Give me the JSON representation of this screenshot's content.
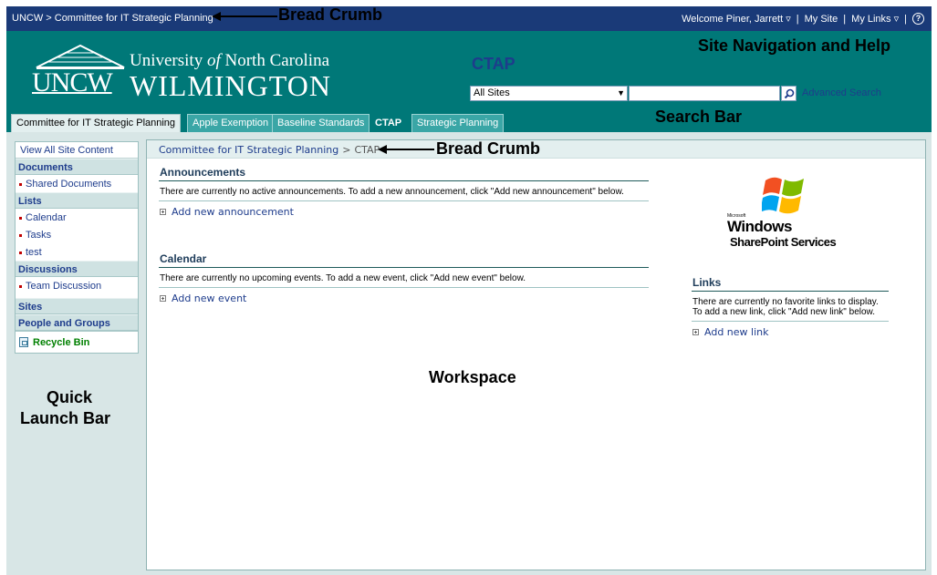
{
  "topbar": {
    "breadcrumb": "UNCW > Committee for IT Strategic Planning",
    "welcome": "Welcome Piner, Jarrett ▿",
    "sep": "|",
    "my_site": "My Site",
    "my_links": "My Links ▿",
    "help_glyph": "?"
  },
  "header": {
    "logo_abbr": "UNCW",
    "logo_line1_a": "University ",
    "logo_line1_of": "of",
    "logo_line1_b": " North Carolina",
    "logo_line2": "WILMINGTON",
    "site_title": "CTAP",
    "search_scope": "All Sites",
    "search_value": "",
    "advanced_search": "Advanced Search"
  },
  "tabs": [
    {
      "label": "Committee for IT Strategic Planning"
    },
    {
      "label": "Apple Exemption"
    },
    {
      "label": "Baseline Standards"
    },
    {
      "label": "CTAP"
    },
    {
      "label": "Strategic Planning"
    }
  ],
  "quicklaunch": {
    "view_all": "View All Site Content",
    "documents": "Documents",
    "shared_documents": "Shared Documents",
    "lists": "Lists",
    "calendar": "Calendar",
    "tasks": "Tasks",
    "test": "test",
    "discussions": "Discussions",
    "team_discussion": "Team Discussion",
    "sites": "Sites",
    "people_groups": "People and Groups",
    "recycle_bin": "Recycle Bin"
  },
  "workspace": {
    "breadcrumb_parent": "Committee for IT Strategic Planning",
    "breadcrumb_sep": ">",
    "breadcrumb_current": "CTAP",
    "announcements": {
      "title": "Announcements",
      "body": "There are currently no active announcements. To add a new announcement, click \"Add new announcement\" below.",
      "add": "Add new announcement"
    },
    "calendar": {
      "title": "Calendar",
      "body": "There are currently no upcoming events. To add a new event, click \"Add new event\" below.",
      "add": "Add new event"
    },
    "links": {
      "title": "Links",
      "body": "There are currently no favorite links to display. To add a new link, click \"Add new link\" below.",
      "add": "Add new link"
    },
    "wss_logo": {
      "microsoft": "Microsoft",
      "windows": "Windows",
      "sharepoint": "SharePoint Services"
    }
  },
  "callouts": {
    "breadcrumb_top": "Bread Crumb",
    "site_nav_help": "Site Navigation and Help",
    "search_bar": "Search Bar",
    "breadcrumb_workspace": "Bread Crumb",
    "workspace": "Workspace",
    "quick_launch_1": "Quick",
    "quick_launch_2": "Launch Bar"
  },
  "colors": {
    "topbar": "#1a3a78",
    "header_teal": "#007878",
    "link_blue": "#1e3c8c",
    "recycle_green": "#008000"
  }
}
